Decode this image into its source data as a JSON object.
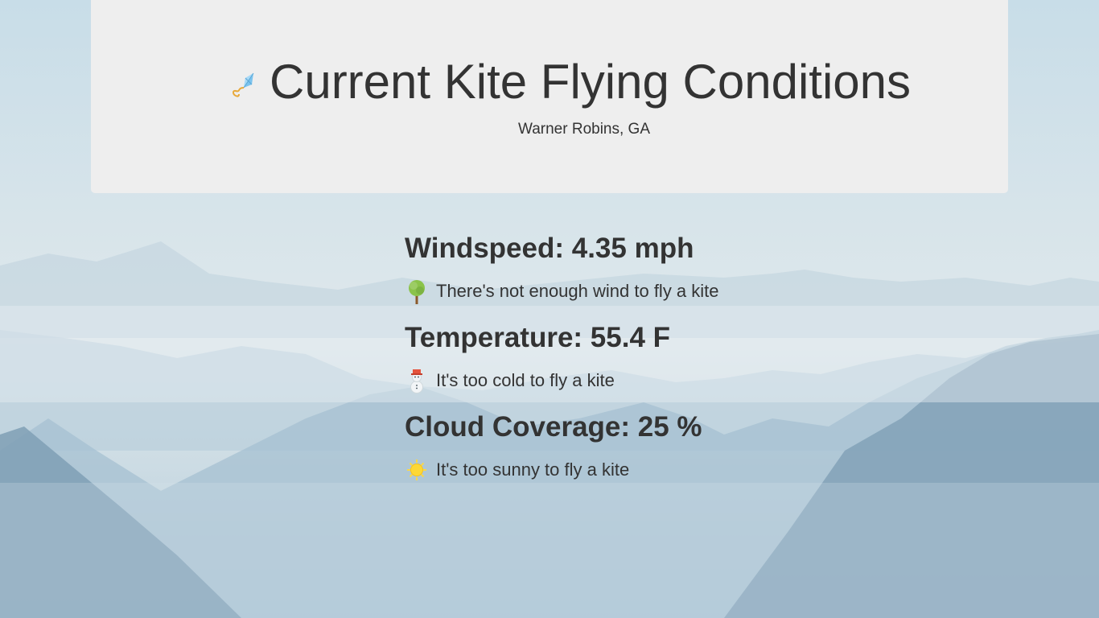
{
  "header": {
    "kite_icon": "kite-icon",
    "title": "Current Kite Flying Conditions",
    "location": "Warner Robins, GA"
  },
  "conditions": [
    {
      "heading": "Windspeed: 4.35 mph",
      "icon": "tree-icon",
      "message": "There's not enough wind to fly a kite"
    },
    {
      "heading": "Temperature: 55.4 F",
      "icon": "snowman-icon",
      "message": "It's too cold to fly a kite"
    },
    {
      "heading": "Cloud Coverage: 25 %",
      "icon": "sun-icon",
      "message": "It's too sunny to fly a kite"
    }
  ],
  "colors": {
    "card_background": "#eeeeee",
    "text": "#333333",
    "mountains": "#7f9fb5"
  }
}
